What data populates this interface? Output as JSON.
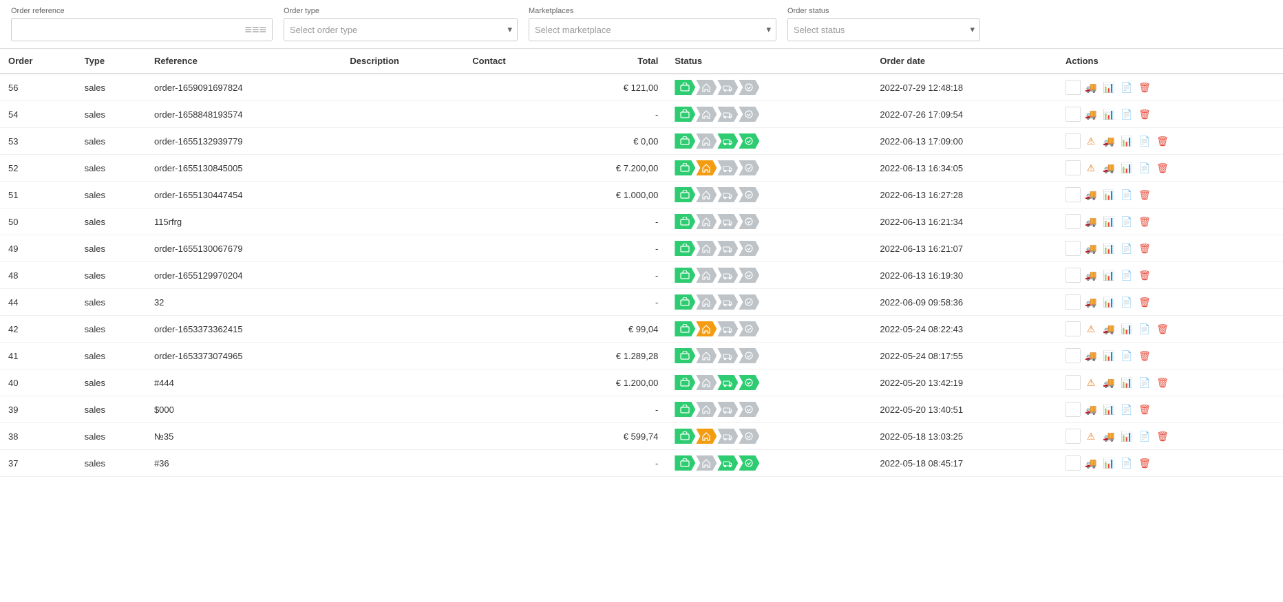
{
  "filters": {
    "order_reference_label": "Order reference",
    "order_reference_placeholder": "",
    "order_type_label": "Order type",
    "order_type_placeholder": "Select order type",
    "marketplaces_label": "Marketplaces",
    "marketplaces_placeholder": "Select marketplace",
    "order_status_label": "Order status",
    "order_status_placeholder": "Select status"
  },
  "table": {
    "columns": [
      "Order",
      "Type",
      "Reference",
      "Description",
      "Contact",
      "Total",
      "Status",
      "Order date",
      "Actions"
    ],
    "rows": [
      {
        "order": "56",
        "type": "sales",
        "reference": "order-1659091697824",
        "description": "",
        "contact": "",
        "total": "€ 121,00",
        "status": [
          1,
          0,
          0,
          0
        ],
        "date": "2022-07-29 12:48:18"
      },
      {
        "order": "54",
        "type": "sales",
        "reference": "order-1658848193574",
        "description": "",
        "contact": "",
        "total": "-",
        "status": [
          1,
          0,
          0,
          0
        ],
        "date": "2022-07-26 17:09:54"
      },
      {
        "order": "53",
        "type": "sales",
        "reference": "order-1655132939779",
        "description": "",
        "contact": "",
        "total": "€ 0,00",
        "status": [
          1,
          0,
          1,
          1
        ],
        "date": "2022-06-13 17:09:00"
      },
      {
        "order": "52",
        "type": "sales",
        "reference": "order-1655130845005",
        "description": "",
        "contact": "",
        "total": "€ 7.200,00",
        "status": [
          1,
          2,
          0,
          0
        ],
        "date": "2022-06-13 16:34:05"
      },
      {
        "order": "51",
        "type": "sales",
        "reference": "order-1655130447454",
        "description": "",
        "contact": "",
        "total": "€ 1.000,00",
        "status": [
          1,
          0,
          0,
          0
        ],
        "date": "2022-06-13 16:27:28"
      },
      {
        "order": "50",
        "type": "sales",
        "reference": "115rfrg",
        "description": "",
        "contact": "",
        "total": "-",
        "status": [
          1,
          0,
          0,
          0
        ],
        "date": "2022-06-13 16:21:34"
      },
      {
        "order": "49",
        "type": "sales",
        "reference": "order-1655130067679",
        "description": "",
        "contact": "",
        "total": "-",
        "status": [
          1,
          0,
          0,
          0
        ],
        "date": "2022-06-13 16:21:07"
      },
      {
        "order": "48",
        "type": "sales",
        "reference": "order-1655129970204",
        "description": "",
        "contact": "",
        "total": "-",
        "status": [
          1,
          0,
          0,
          0
        ],
        "date": "2022-06-13 16:19:30"
      },
      {
        "order": "44",
        "type": "sales",
        "reference": "32",
        "description": "",
        "contact": "",
        "total": "-",
        "status": [
          1,
          0,
          0,
          0
        ],
        "date": "2022-06-09 09:58:36"
      },
      {
        "order": "42",
        "type": "sales",
        "reference": "order-1653373362415",
        "description": "",
        "contact": "",
        "total": "€ 99,04",
        "status": [
          1,
          2,
          0,
          0
        ],
        "date": "2022-05-24 08:22:43"
      },
      {
        "order": "41",
        "type": "sales",
        "reference": "order-1653373074965",
        "description": "",
        "contact": "",
        "total": "€ 1.289,28",
        "status": [
          1,
          0,
          0,
          0
        ],
        "date": "2022-05-24 08:17:55"
      },
      {
        "order": "40",
        "type": "sales",
        "reference": "#444",
        "description": "",
        "contact": "",
        "total": "€ 1.200,00",
        "status": [
          1,
          0,
          1,
          1
        ],
        "date": "2022-05-20 13:42:19"
      },
      {
        "order": "39",
        "type": "sales",
        "reference": "$000",
        "description": "",
        "contact": "",
        "total": "-",
        "status": [
          1,
          0,
          0,
          0
        ],
        "date": "2022-05-20 13:40:51"
      },
      {
        "order": "38",
        "type": "sales",
        "reference": "№35",
        "description": "",
        "contact": "",
        "total": "€ 599,74",
        "status": [
          1,
          2,
          0,
          0
        ],
        "date": "2022-05-18 13:03:25"
      },
      {
        "order": "37",
        "type": "sales",
        "reference": "#36",
        "description": "",
        "contact": "",
        "total": "-",
        "status": [
          1,
          0,
          1,
          1
        ],
        "date": "2022-05-18 08:45:17"
      }
    ]
  }
}
